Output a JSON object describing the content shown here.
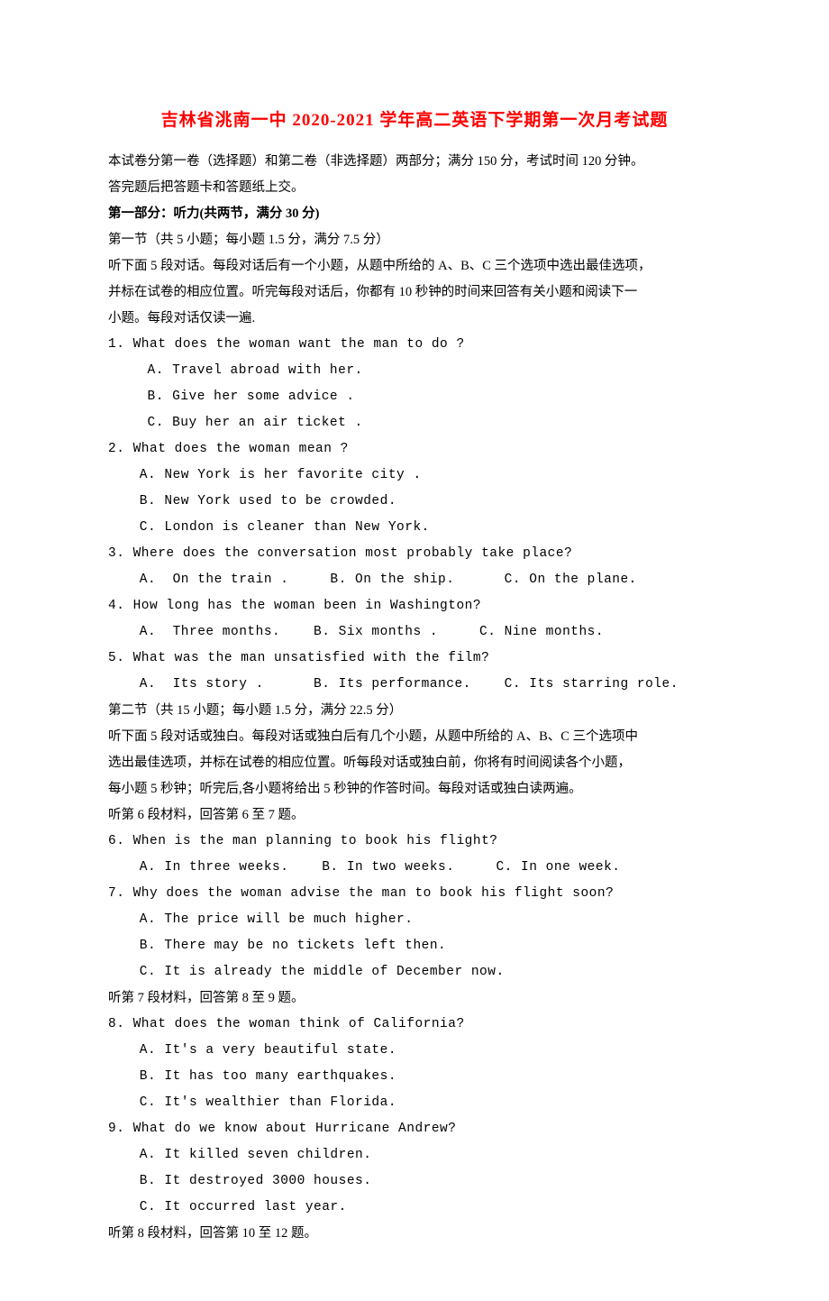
{
  "title": "吉林省洮南一中 2020-2021 学年高二英语下学期第一次月考试题",
  "intro1": "本试卷分第一卷（选择题）和第二卷（非选择题）两部分；满分 150 分，考试时间 120 分钟。",
  "intro2": "答完题后把答题卡和答题纸上交。",
  "part1_heading": "第一部分：听力(共两节，满分 30 分)",
  "sec1_heading": "第一节（共 5 小题；每小题 1.5 分，满分 7.5 分）",
  "sec1_instr1": "听下面 5 段对话。每段对话后有一个小题，从题中所给的 A、B、C 三个选项中选出最佳选项，",
  "sec1_instr2": "并标在试卷的相应位置。听完每段对话后，你都有 10 秒钟的时间来回答有关小题和阅读下一",
  "sec1_instr3": "小题。每段对话仅读一遍.",
  "q1": "1. What does the woman want the man to do ?",
  "q1a": "A.   Travel abroad with her.",
  "q1b": "B.   Give her some advice .",
  "q1c": "C.   Buy her an air ticket .",
  "q2": "2. What does the woman mean ?",
  "q2a": "A.  New York is her favorite city .",
  "q2b": "B.  New York used to be crowded.",
  "q2c": "C.  London is cleaner than New York.",
  "q3": "3. Where does the conversation most probably take place?",
  "q3opts": "A.  On the train .     B. On the ship.      C. On the plane.",
  "q4": "4. How long has the woman been in Washington?",
  "q4opts": "A.  Three months.    B. Six months .     C. Nine months.",
  "q5": "5. What was the man unsatisfied with the film?",
  "q5opts": "A.  Its story .      B. Its performance.    C. Its starring role.",
  "sec2_heading": "第二节（共 15 小题；每小题 1.5 分，满分 22.5 分）",
  "sec2_instr1": "听下面 5 段对话或独白。每段对话或独白后有几个小题，从题中所给的 A、B、C 三个选项中",
  "sec2_instr2": "选出最佳选项，并标在试卷的相应位置。听每段对话或独白前，你将有时间阅读各个小题，",
  "sec2_instr3": "每小题 5 秒钟；听完后,各小题将给出 5 秒钟的作答时间。每段对话或独白读两遍。",
  "seg6": "听第 6 段材料，回答第 6 至 7 题。",
  "q6": "6. When is the man planning to book his flight?",
  "q6opts": "A. In three weeks.    B. In two weeks.     C. In one week.",
  "q7": "7. Why does the woman advise the  man to book his flight soon?",
  "q7a": "A. The price will be much higher.",
  "q7b": "B. There may be no tickets left then.",
  "q7c": "C. It is already the middle of December now.",
  "seg7": "听第 7 段材料，回答第 8 至 9 题。",
  "q8": "8. What does the woman think of California?",
  "q8a": "A. It's a very beautiful state.",
  "q8b": "B. It has too many earthquakes.",
  "q8c": "C. It's wealthier than Florida.",
  "q9": "9. What do we know about Hurricane Andrew?",
  "q9a": "A. It killed seven children.",
  "q9b": "B. It destroyed 3000 houses.",
  "q9c": "C. It occurred last year.",
  "seg8": "听第 8 段材料，回答第 10 至 12 题。"
}
